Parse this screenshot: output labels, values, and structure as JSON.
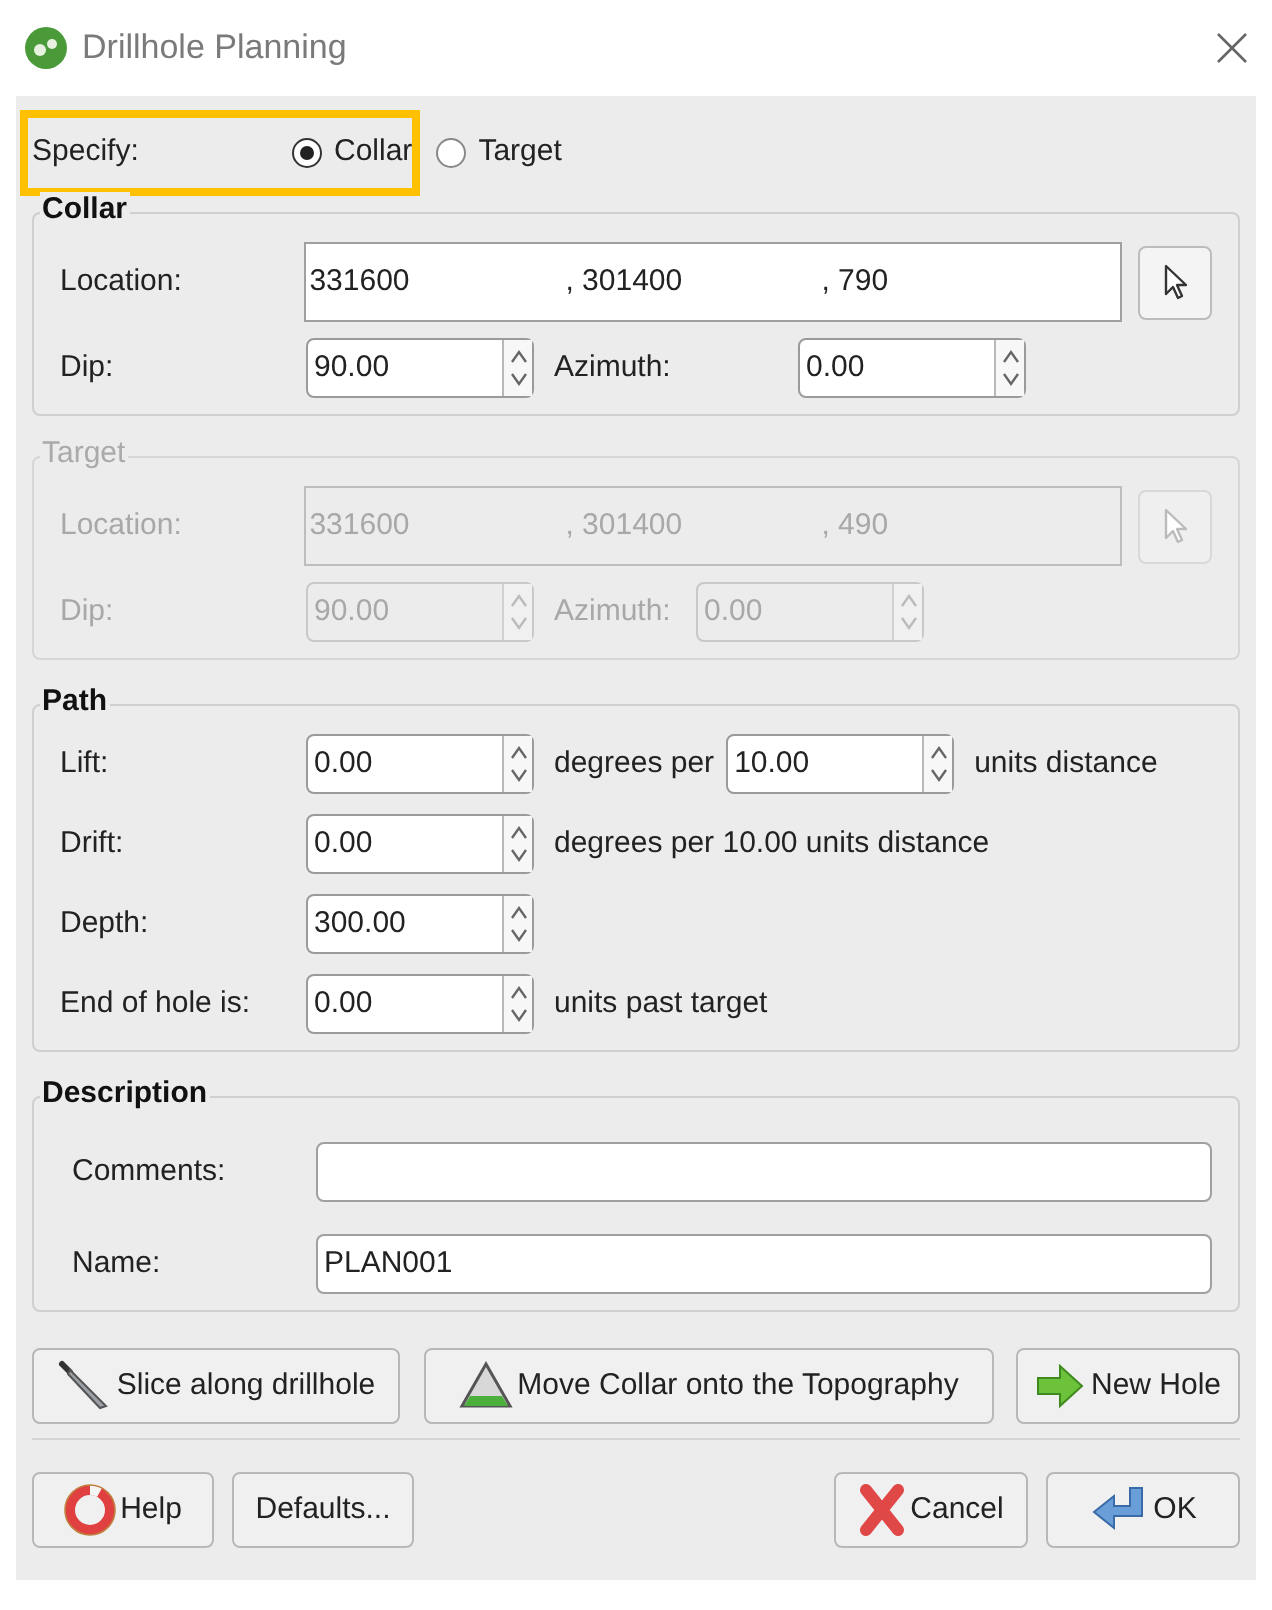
{
  "window": {
    "title": "Drillhole Planning"
  },
  "specify": {
    "label": "Specify:",
    "highlighted": true,
    "options": [
      {
        "label": "Collar",
        "selected": true
      },
      {
        "label": "Target",
        "selected": false
      }
    ]
  },
  "groups": [
    {
      "title": "Collar",
      "disabled": false,
      "location": {
        "label": "Location:",
        "separator": ",",
        "values": [
          "331600",
          "301400",
          "790"
        ]
      },
      "dip": {
        "label": "Dip:",
        "value": "90.00"
      },
      "azimuth": {
        "label": "Azimuth:",
        "value": "0.00"
      }
    },
    {
      "title": "Target",
      "disabled": true,
      "location": {
        "label": "Location:",
        "separator": ",",
        "values": [
          "331600",
          "301400",
          "490"
        ]
      },
      "dip": {
        "label": "Dip:",
        "value": "90.00"
      },
      "azimuth": {
        "label": "Azimuth:",
        "value": "0.00"
      }
    }
  ],
  "path": {
    "title": "Path",
    "rows": [
      {
        "label": "Lift:",
        "value": "0.00",
        "after": [
          {
            "kind": "text",
            "text": "degrees per"
          },
          {
            "kind": "spin",
            "value": "10.00"
          },
          {
            "kind": "text",
            "text": "units distance"
          }
        ]
      },
      {
        "label": "Drift:",
        "value": "0.00",
        "after": [
          {
            "kind": "text",
            "text": "degrees per 10.00 units distance"
          }
        ]
      },
      {
        "label": "Depth:",
        "value": "300.00"
      },
      {
        "label": "End of hole is:",
        "value": "0.00",
        "after": [
          {
            "kind": "text",
            "text": "units past target"
          }
        ]
      }
    ]
  },
  "description": {
    "title": "Description",
    "fields": [
      {
        "label": "Comments:"
      },
      {
        "label": "Name:",
        "value": "PLAN001"
      }
    ]
  },
  "action_buttons": [
    {
      "label": "Slice along drillhole"
    },
    {
      "label": "Move Collar onto the Topography"
    },
    {
      "label": "New Hole"
    }
  ],
  "bottom_buttons_left": [
    {
      "label": "Help"
    },
    {
      "label": "Defaults..."
    }
  ],
  "bottom_buttons_right": [
    {
      "label": "Cancel"
    },
    {
      "label": "OK"
    }
  ]
}
